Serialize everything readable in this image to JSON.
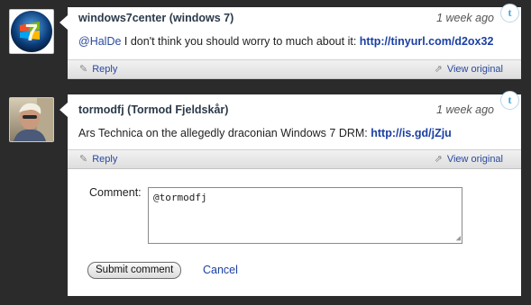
{
  "tweets": [
    {
      "author": "windows7center (windows 7)",
      "time": "1 week ago",
      "mention": "@HalDe",
      "text": " I don't think you should worry to much about it: ",
      "link": "http://tinyurl.com/d2ox32",
      "reply_label": "Reply",
      "view_original_label": "View original",
      "avatar_icon": "windows-7-logo",
      "source_icon": "twitter-icon"
    },
    {
      "author": "tormodfj (Tormod Fjeldskår)",
      "time": "1 week ago",
      "text": "Ars Technica on the allegedly draconian Windows 7 DRM: ",
      "link": "http://is.gd/jZju",
      "reply_label": "Reply",
      "view_original_label": "View original",
      "avatar_icon": "user-photo",
      "source_icon": "twitter-icon"
    }
  ],
  "comment_form": {
    "label": "Comment:",
    "value": "@tormodfj",
    "submit_label": "Submit comment",
    "cancel_label": "Cancel"
  },
  "colors": {
    "background": "#2b2b2b",
    "link": "#1a3fa3",
    "author": "#2b3a4a"
  }
}
